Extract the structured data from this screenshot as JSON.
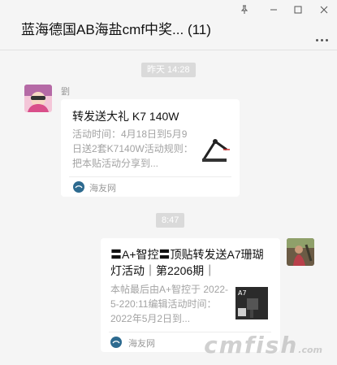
{
  "window": {
    "title": "蓝海德国AB海盐cmf中奖... (11)",
    "pin_icon": "pin-icon",
    "minimize_icon": "minimize-icon",
    "maximize_icon": "maximize-icon",
    "close_icon": "close-icon",
    "more_icon": "more-icon"
  },
  "messages": [
    {
      "timestamp": "昨天 14:28",
      "sender": "劉",
      "card": {
        "title": "转发送大礼 K7 140W",
        "desc": "活动时间：4月18日到5月9日送2套K7140W活动规则：把本贴活动分享到...",
        "source": "海友网"
      }
    },
    {
      "timestamp": "8:47",
      "card": {
        "title": "〓A+智控〓顶贴转发送A7珊瑚灯活动｜第2206期｜",
        "desc": "本帖最后由A+智控于 2022-5-220:11编辑活动时间：2022年5月2日到...",
        "source": "海友网"
      }
    }
  ],
  "watermark": {
    "text": "cmfish",
    "suffix": ".com"
  },
  "colors": {
    "background": "#f5f5f5",
    "card": "#ffffff",
    "timestamp_bg": "#dadada",
    "source_icon": "#2d6a8f"
  }
}
